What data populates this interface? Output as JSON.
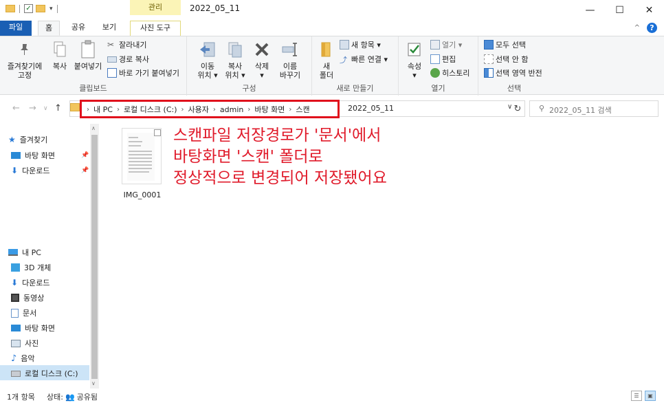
{
  "window": {
    "title": "2022_05_11",
    "context_tab_header": "관리"
  },
  "tabs": {
    "file": "파일",
    "home": "홈",
    "share": "공유",
    "view": "보기",
    "picture_tools": "사진 도구"
  },
  "ribbon": {
    "clipboard": {
      "label": "클립보드",
      "pin_quick": "즐겨찾기에\n고정",
      "pin_quick_l1": "즐겨찾기에",
      "pin_quick_l2": "고정",
      "copy": "복사",
      "paste": "붙여넣기",
      "cut": "잘라내기",
      "copy_path": "경로 복사",
      "paste_shortcut": "바로 가기 붙여넣기"
    },
    "organize": {
      "label": "구성",
      "move_l1": "이동",
      "move_l2": "위치 ▾",
      "copy_l1": "복사",
      "copy_l2": "위치 ▾",
      "delete": "삭제",
      "delete_l2": "▾",
      "rename_l1": "이름",
      "rename_l2": "바꾸기"
    },
    "new": {
      "label": "새로 만들기",
      "new_folder_l1": "새",
      "new_folder_l2": "폴더",
      "new_item": "새 항목 ▾",
      "easy_access": "빠른 연결 ▾"
    },
    "open": {
      "label": "열기",
      "properties": "속성",
      "properties_l2": "▾",
      "open": "열기 ▾",
      "edit": "편집",
      "history": "히스토리"
    },
    "select": {
      "label": "선택",
      "select_all": "모두 선택",
      "select_none": "선택 안 함",
      "invert": "선택 영역 반전"
    }
  },
  "address": {
    "crumbs": [
      "내 PC",
      "로컬 디스크 (C:)",
      "사용자",
      "admin",
      "바탕 화면",
      "스캔"
    ],
    "current": "2022_05_11",
    "search_placeholder": "2022_05_11 검색"
  },
  "sidebar": {
    "quick_access": "즐겨찾기",
    "quick_items": [
      "바탕 화면",
      "다운로드"
    ],
    "this_pc": "내 PC",
    "pc_items": [
      "3D 개체",
      "다운로드",
      "동영상",
      "문서",
      "바탕 화면",
      "사진",
      "음악",
      "로컬 디스크 (C:)"
    ]
  },
  "files": [
    {
      "name": "IMG_0001"
    }
  ],
  "annotation": {
    "lines": [
      "스캔파일 저장경로가 '문서'에서",
      "바탕화면 '스캔' 폴더로",
      "정상적으로 변경되어 저장됐어요"
    ]
  },
  "status": {
    "count": "1개 항목",
    "state_label": "상태:",
    "state_value": "공유됨"
  },
  "colors": {
    "accent": "#1a5fb4",
    "annotation": "#e01a2a",
    "context_tab": "#fbf4b7",
    "selection": "#cce4f7"
  }
}
